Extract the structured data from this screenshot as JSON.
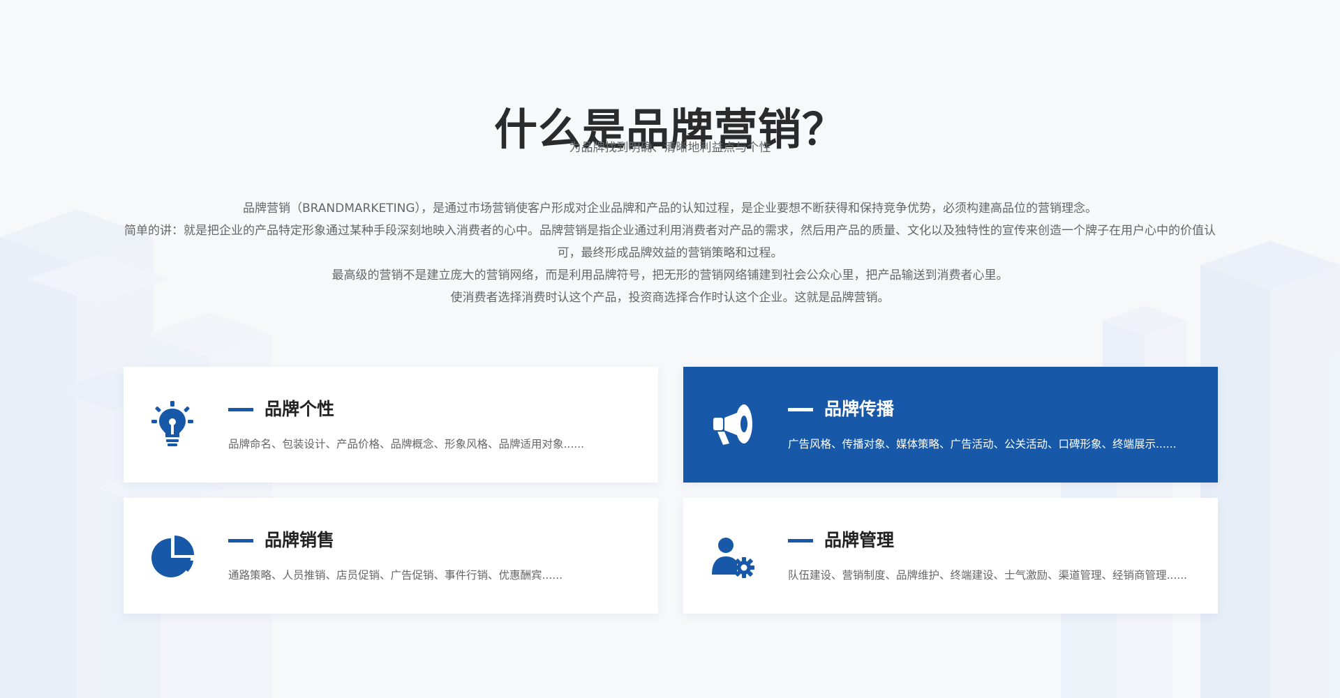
{
  "header": {
    "title": "什么是品牌营销？",
    "subtitle": "为品牌找到明确、清晰地利益点与个性"
  },
  "intro": {
    "lines": [
      "品牌营销（BRANDMARKETING），是通过市场营销使客户形成对企业品牌和产品的认知过程，是企业要想不断获得和保持竞争优势，必须构建高品位的营销理念。",
      "简单的讲：就是把企业的产品特定形象通过某种手段深刻地映入消费者的心中。品牌营销是指企业通过利用消费者对产品的需求，然后用产品的质量、文化以及独特性的宣传来创造一个牌子在用户心中的价值认可，最终形成品牌效益的营销策略和过程。",
      "最高级的营销不是建立庞大的营销网络，而是利用品牌符号，把无形的营销网络铺建到社会公众心里，把产品输送到消费者心里。",
      "使消费者选择消费时认这个产品，投资商选择合作时认这个企业。这就是品牌营销。"
    ]
  },
  "cards": [
    {
      "title": "品牌个性",
      "description": "品牌命名、包装设计、产品价格、品牌概念、形象风格、品牌适用对象......",
      "icon": "lightbulb-icon",
      "active": false
    },
    {
      "title": "品牌传播",
      "description": "广告风格、传播对象、媒体策略、广告活动、公关活动、口碑形象、终端展示......",
      "icon": "megaphone-icon",
      "active": true
    },
    {
      "title": "品牌销售",
      "description": "通路策略、人员推销、店员促销、广告促销、事件行销、优惠酬宾......",
      "icon": "pie-chart-icon",
      "active": false
    },
    {
      "title": "品牌管理",
      "description": "队伍建设、营销制度、品牌维护、终端建设、士气激励、渠道管理、经销商管理......",
      "icon": "user-gear-icon",
      "active": false
    }
  ],
  "colors": {
    "brand_blue": "#1759a8",
    "background": "#f7f8fa",
    "card_background": "#ffffff",
    "text_dark": "#222222",
    "text_muted": "#666666"
  }
}
